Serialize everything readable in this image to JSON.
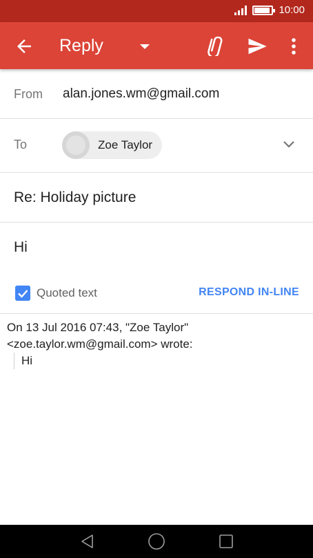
{
  "status_bar": {
    "time": "10:00",
    "battery_level": 0.9
  },
  "app_bar": {
    "title": "Reply",
    "icons": [
      "arrow-back-icon",
      "dropdown-caret-icon",
      "paperclip-icon",
      "send-icon",
      "more-vert-icon"
    ]
  },
  "from": {
    "label": "From",
    "value": "alan.jones.wm@gmail.com"
  },
  "to": {
    "label": "To",
    "recipient": "Zoe Taylor"
  },
  "subject": "Re: Holiday picture",
  "body": "Hi",
  "quoted": {
    "checkbox_checked": true,
    "label": "Quoted text",
    "respond_button": "RESPOND IN-LINE",
    "header_line1": "On 13 Jul 2016 07:43, \"Zoe Taylor\"",
    "header_line2": "<zoe.taylor.wm@gmail.com> wrote:",
    "text": "Hi"
  },
  "colors": {
    "status_bar": "#b3281d",
    "app_bar": "#db4437",
    "accent": "#4285f4"
  },
  "nav_bar": {
    "icons": [
      "nav-back-icon",
      "nav-home-icon",
      "nav-recents-icon"
    ]
  }
}
